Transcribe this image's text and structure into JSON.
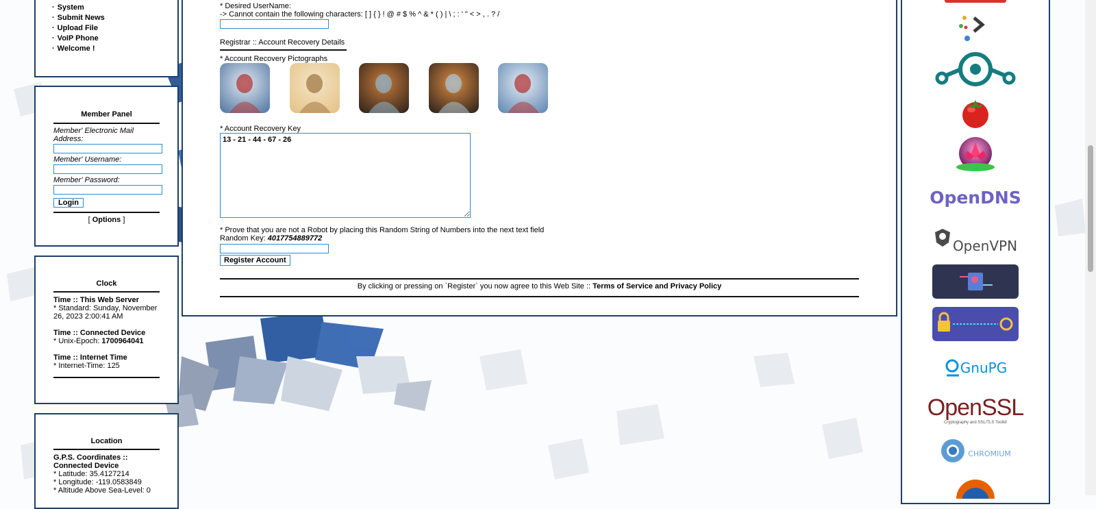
{
  "nav": {
    "items": [
      "System",
      "Submit News",
      "Upload File",
      "VoIP Phone",
      "Welcome !"
    ]
  },
  "member_panel": {
    "title": "Member Panel",
    "email_label": "Member' Electronic Mail Address:",
    "username_label": "Member' Username:",
    "password_label": "Member' Password:",
    "login_button": "Login",
    "options_prefix": "[ ",
    "options_link": "Options",
    "options_suffix": " ]"
  },
  "clock": {
    "title": "Clock",
    "server_heading": "Time :: This Web Server",
    "server_value": "* Standard: Sunday, November 26, 2023 2:00:41 AM",
    "device_heading": "Time :: Connected Device",
    "device_prefix": "* Unix-Epoch: ",
    "device_value": "1700964041",
    "internet_heading": "Time :: Internet Time",
    "internet_value": "* Internet-Time: 125"
  },
  "location": {
    "title": "Location",
    "heading": "G.P.S. Coordinates :: Connected Device",
    "latitude": "* Latitude: 35.4127214",
    "longitude": "* Longitude: -119.0583849",
    "altitude": "* Altitude Above Sea-Level: 0"
  },
  "registration": {
    "desired_username_label": "* Desired UserName:",
    "username_rule": "-> Cannot contain the following characters: [ ] { } ! @ # $ % ^ & * ( ) | \\ ; : ' \" < > , . ? /",
    "section_title": "Registrar :: Account Recovery Details",
    "pictographs_label": "* Account Recovery Pictographs",
    "pictographs": [
      {
        "name": "dancer-pictograph",
        "colors": [
          "#5d7fa8",
          "#b23a3a",
          "#dfe7ef"
        ]
      },
      {
        "name": "goddess-pictograph",
        "colors": [
          "#e6c58b",
          "#a27a45",
          "#f3e4c6"
        ]
      },
      {
        "name": "old-man-pictograph",
        "colors": [
          "#3a2a1e",
          "#8fb3c9",
          "#c77a3a"
        ]
      },
      {
        "name": "old-man-pictograph-2",
        "colors": [
          "#3a2a1e",
          "#a8c4d4",
          "#d88a42"
        ]
      },
      {
        "name": "dancer-pictograph-2",
        "colors": [
          "#6b8fb8",
          "#b23a3a",
          "#e4ebf2"
        ]
      }
    ],
    "recovery_key_label": "* Account Recovery Key",
    "recovery_key_value": "13 - 21 - 44 - 67 - 26",
    "robot_prompt": "* Prove that you are not a Robot by placing this Random String of Numbers into the next text field",
    "random_key_label": "Random Key: ",
    "random_key_value": "4017754889772",
    "register_button": "Register Account",
    "agreement_prefix": "By clicking or pressing on `Register` you now agree to this Web Site :: ",
    "agreement_link": "Terms of Service and Privacy Policy"
  },
  "logos": {
    "opendns": "OpenDNS",
    "openvpn": "OpenVPN",
    "gnupg": "GnuPG",
    "openssl_main": "OpenSSL",
    "openssl_tagline": "Cryptography and SSL/TLS Toolkit",
    "chromium": "CHROMIUM"
  },
  "colors": {
    "border": "#1d3f66",
    "field_border": "#2a8bd0",
    "opendns": "#6d62c4",
    "openssl": "#7a1f1f"
  }
}
